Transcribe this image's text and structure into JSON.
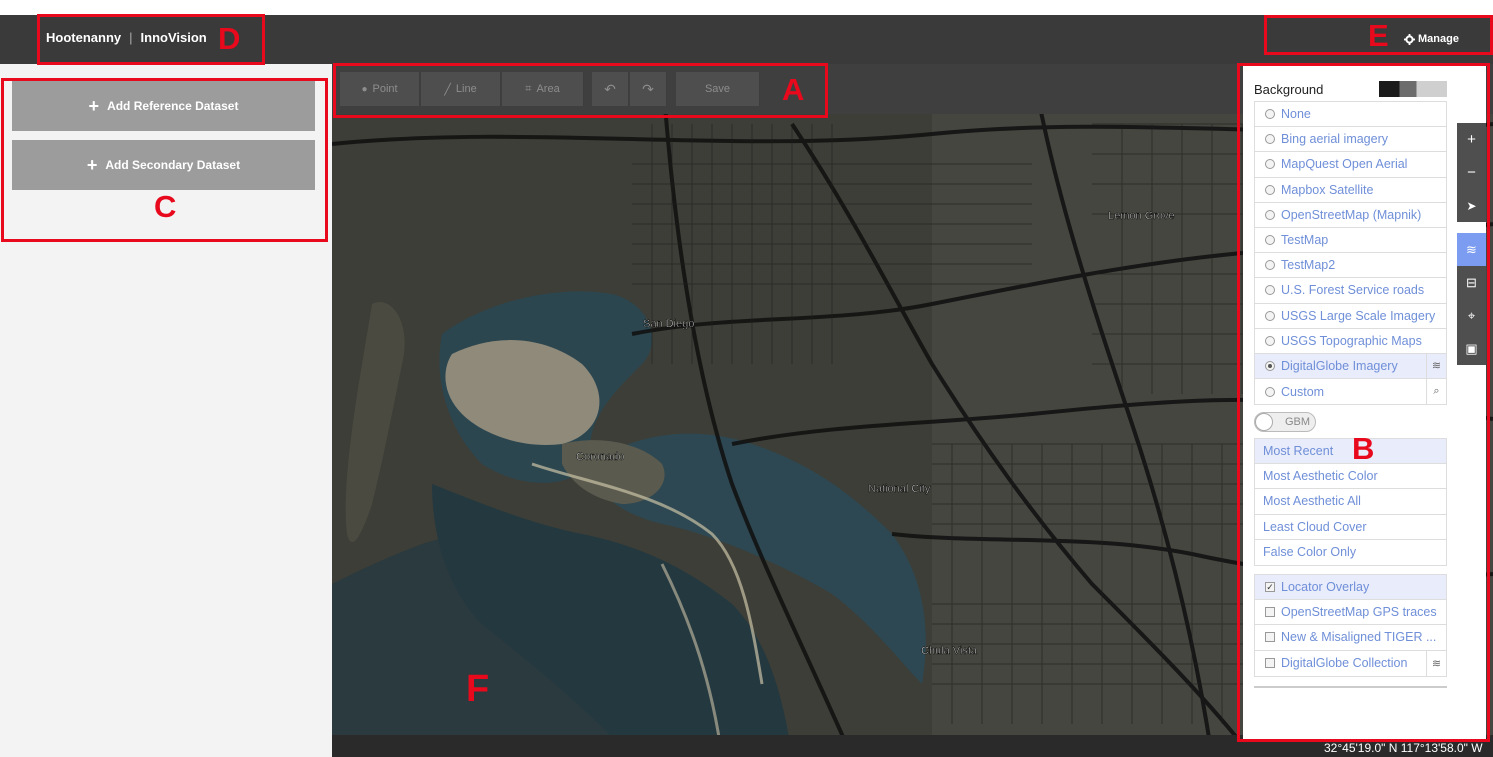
{
  "app": {
    "name": "Hootenanny",
    "product": "InnoVision",
    "manage_label": "Manage"
  },
  "left_panel": {
    "add_reference": "Add Reference Dataset",
    "add_secondary": "Add Secondary Dataset"
  },
  "toolbar": {
    "point": "Point",
    "line": "Line",
    "area": "Area",
    "save": "Save"
  },
  "background": {
    "title": "Background",
    "sources": [
      {
        "label": "None",
        "selected": false
      },
      {
        "label": "Bing aerial imagery",
        "selected": false
      },
      {
        "label": "MapQuest Open Aerial",
        "selected": false
      },
      {
        "label": "Mapbox Satellite",
        "selected": false
      },
      {
        "label": "OpenStreetMap (Mapnik)",
        "selected": false
      },
      {
        "label": "TestMap",
        "selected": false
      },
      {
        "label": "TestMap2",
        "selected": false
      },
      {
        "label": "U.S. Forest Service roads",
        "selected": false
      },
      {
        "label": "USGS Large Scale Imagery",
        "selected": false
      },
      {
        "label": "USGS Topographic Maps",
        "selected": false
      },
      {
        "label": "DigitalGlobe Imagery",
        "selected": true
      },
      {
        "label": "Custom",
        "selected": false
      }
    ],
    "gbm_label": "GBM",
    "profiles": [
      {
        "label": "Most Recent",
        "selected": true
      },
      {
        "label": "Most Aesthetic Color",
        "selected": false
      },
      {
        "label": "Most Aesthetic All",
        "selected": false
      },
      {
        "label": "Least Cloud Cover",
        "selected": false
      },
      {
        "label": "False Color Only",
        "selected": false
      }
    ],
    "overlays": [
      {
        "label": "Locator Overlay",
        "checked": true
      },
      {
        "label": "OpenStreetMap GPS traces",
        "checked": false
      },
      {
        "label": "New & Misaligned TIGER ...",
        "checked": false
      },
      {
        "label": "DigitalGlobe Collection",
        "checked": false
      }
    ]
  },
  "map": {
    "coordinates": "32°45'19.0\" N 117°13'58.0\" W",
    "place_labels": [
      "San Diego",
      "Coronado",
      "Lemon Grove",
      "National City",
      "Chula Vista"
    ]
  },
  "annotations": [
    "A",
    "B",
    "C",
    "D",
    "E",
    "F"
  ],
  "colors": {
    "annotation": "#e8091d",
    "link": "#6f8fd8",
    "active_control": "#7b9cf0"
  }
}
